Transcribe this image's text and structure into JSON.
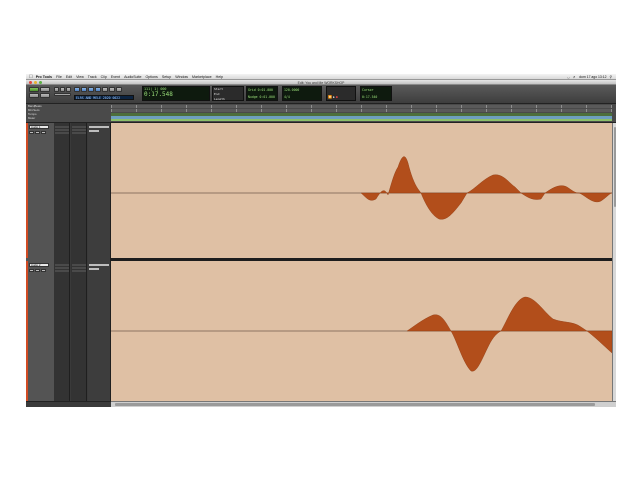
{
  "menubar": {
    "app_name": "Pro Tools",
    "items": [
      "File",
      "Edit",
      "View",
      "Track",
      "Clip",
      "Event",
      "AudioSuite",
      "Options",
      "Setup",
      "Window",
      "Marketplace",
      "Help"
    ],
    "clock": "dom 17 ago 13:12"
  },
  "window": {
    "title": "Edit: You and Me WORKSHOP"
  },
  "toolbar": {
    "main_counter": "0:17.548",
    "main_counter_upper": "111| 1| 000",
    "start_label": "Start",
    "end_label": "End",
    "length_label": "Length",
    "grid_label": "Grid",
    "nudge_label": "Nudge",
    "grid_value": "0:01.000",
    "nudge_value": "0:01.000",
    "tempo_value": "120.0000",
    "meter_value": "4/4",
    "cursor_label": "Cursor",
    "cursor_value": "0:17.540",
    "track_info": "ELRS AND MELE 2020 0022"
  },
  "rulers": {
    "rows": [
      "Bars|Beats",
      "Min:Secs",
      "Tempo",
      "Meter",
      "Markers"
    ]
  },
  "tracks": [
    {
      "name": "Audio 1"
    },
    {
      "name": "Audio 2"
    }
  ],
  "colors": {
    "waveform": "#b24e1b",
    "lane_bg": "#dfc0a4",
    "clip_strip": "#d14b24"
  }
}
